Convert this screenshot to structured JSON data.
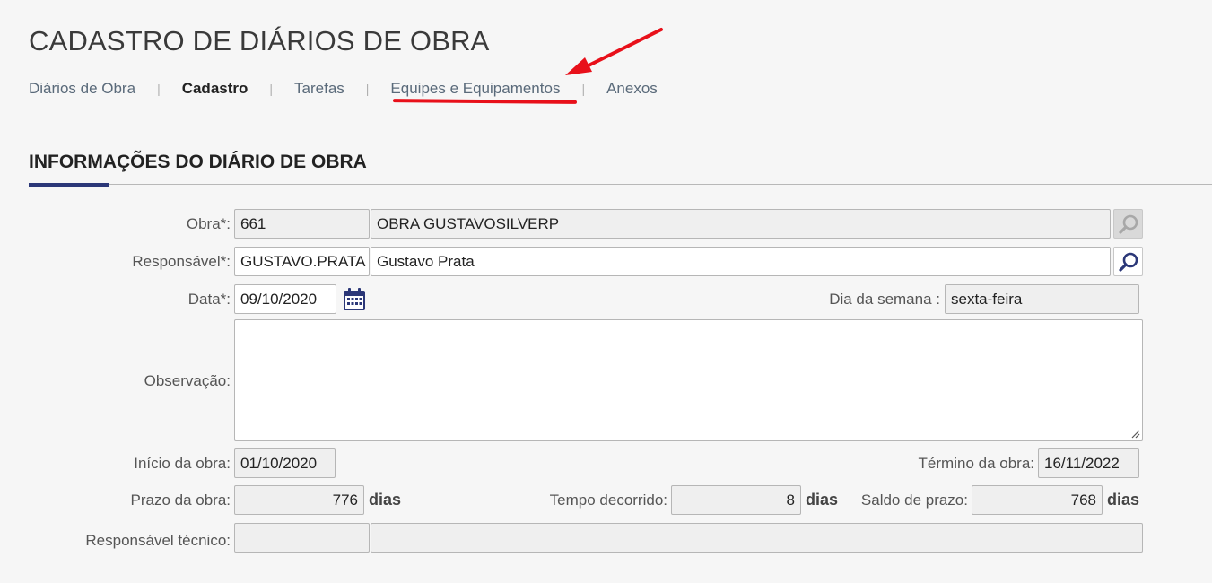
{
  "page": {
    "title": "CADASTRO DE DIÁRIOS DE OBRA"
  },
  "tabs": [
    {
      "label": "Diários de Obra"
    },
    {
      "label": "Cadastro"
    },
    {
      "label": "Tarefas"
    },
    {
      "label": "Equipes e Equipamentos"
    },
    {
      "label": "Anexos"
    }
  ],
  "tab_separator": "|",
  "annotation": {
    "color": "#e8101a",
    "target": "Equipes e Equipamentos"
  },
  "section": {
    "title": "INFORMAÇÕES DO DIÁRIO DE OBRA",
    "accent_color": "#2b3778"
  },
  "form": {
    "obra": {
      "label": "Obra*:",
      "code": "661",
      "name": "OBRA GUSTAVOSILVERP"
    },
    "responsavel": {
      "label": "Responsável*:",
      "code": "GUSTAVO.PRATA",
      "name": "Gustavo Prata"
    },
    "data": {
      "label": "Data*:",
      "value": "09/10/2020"
    },
    "dia_semana": {
      "label": "Dia da semana :",
      "value": "sexta-feira"
    },
    "observacao": {
      "label": "Observação:",
      "value": ""
    },
    "inicio_obra": {
      "label": "Início da obra:",
      "value": "01/10/2020"
    },
    "termino_obra": {
      "label": "Término da obra:",
      "value": "16/11/2022"
    },
    "prazo_obra": {
      "label": "Prazo da obra:",
      "value": "776",
      "unit": "dias"
    },
    "tempo_decorrido": {
      "label": "Tempo decorrido:",
      "value": "8",
      "unit": "dias"
    },
    "saldo_prazo": {
      "label": "Saldo de prazo:",
      "value": "768",
      "unit": "dias"
    },
    "responsavel_tecnico": {
      "label": "Responsável técnico:",
      "code": "",
      "name": ""
    }
  },
  "icons": {
    "search": "search-icon",
    "calendar": "calendar-icon",
    "resize": "resize-grip-icon"
  }
}
